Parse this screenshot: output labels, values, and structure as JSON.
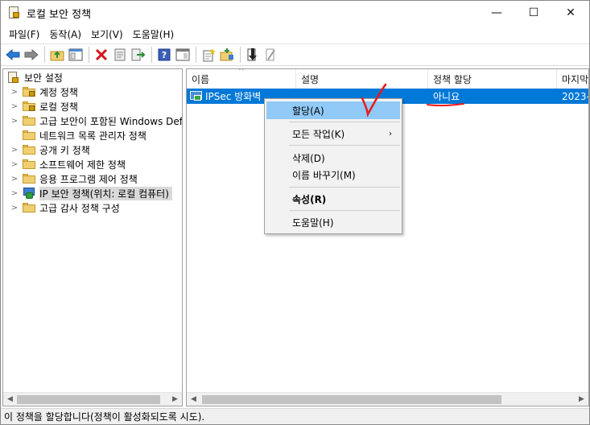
{
  "window": {
    "title": "로컬 보안 정책",
    "controls": {
      "minimize": "—",
      "maximize": "☐",
      "close": "✕"
    }
  },
  "menubar": {
    "items": [
      "파일(F)",
      "동작(A)",
      "보기(V)",
      "도움말(H)"
    ]
  },
  "toolbar": {
    "buttons": [
      "back-arrow-icon",
      "forward-arrow-icon",
      "up-folder-icon",
      "show-tree-icon",
      "delete-icon",
      "properties-icon",
      "export-icon",
      "help-icon",
      "view-icon",
      "new-policy-icon",
      "manage-filters-icon",
      "assign-icon",
      "unassign-icon"
    ]
  },
  "tree": {
    "root": "보안 설정",
    "items": [
      {
        "label": "계정 정책",
        "icon": "lock-folder"
      },
      {
        "label": "로컬 정책",
        "icon": "lock-folder"
      },
      {
        "label": "고급 보안이 포함된 Windows Def",
        "icon": "folder"
      },
      {
        "label": "네트워크 목록 관리자 정책",
        "icon": "folder"
      },
      {
        "label": "공개 키 정책",
        "icon": "folder"
      },
      {
        "label": "소프트웨어 제한 정책",
        "icon": "folder"
      },
      {
        "label": "응용 프로그램 제어 정책",
        "icon": "folder"
      },
      {
        "label": "IP 보안 정책(위치: 로컬 컴퓨터)",
        "icon": "ip-security",
        "selected": true
      },
      {
        "label": "고급 감사 정책 구성",
        "icon": "folder"
      }
    ]
  },
  "list": {
    "columns": [
      "이름",
      "설명",
      "정책 할당",
      "마지막"
    ],
    "rows": [
      {
        "name": "IPSec 방화벽",
        "description": "",
        "assigned": "아니요",
        "modified": "2023-"
      }
    ]
  },
  "context_menu": {
    "items": [
      "할당(A)",
      "모든 작업(K)",
      "삭제(D)",
      "이름 바꾸기(M)",
      "속성(R)",
      "도움말(H)"
    ],
    "highlighted": "할당(A)",
    "submenu_arrow": "›"
  },
  "annotation": {
    "color": "#e8191c"
  },
  "statusbar": {
    "text": "이 정책을 할당합니다(정책이 활성화되도록 시도)."
  },
  "colors": {
    "selection": "#0078d7",
    "menu_highlight": "#91c9f7"
  }
}
